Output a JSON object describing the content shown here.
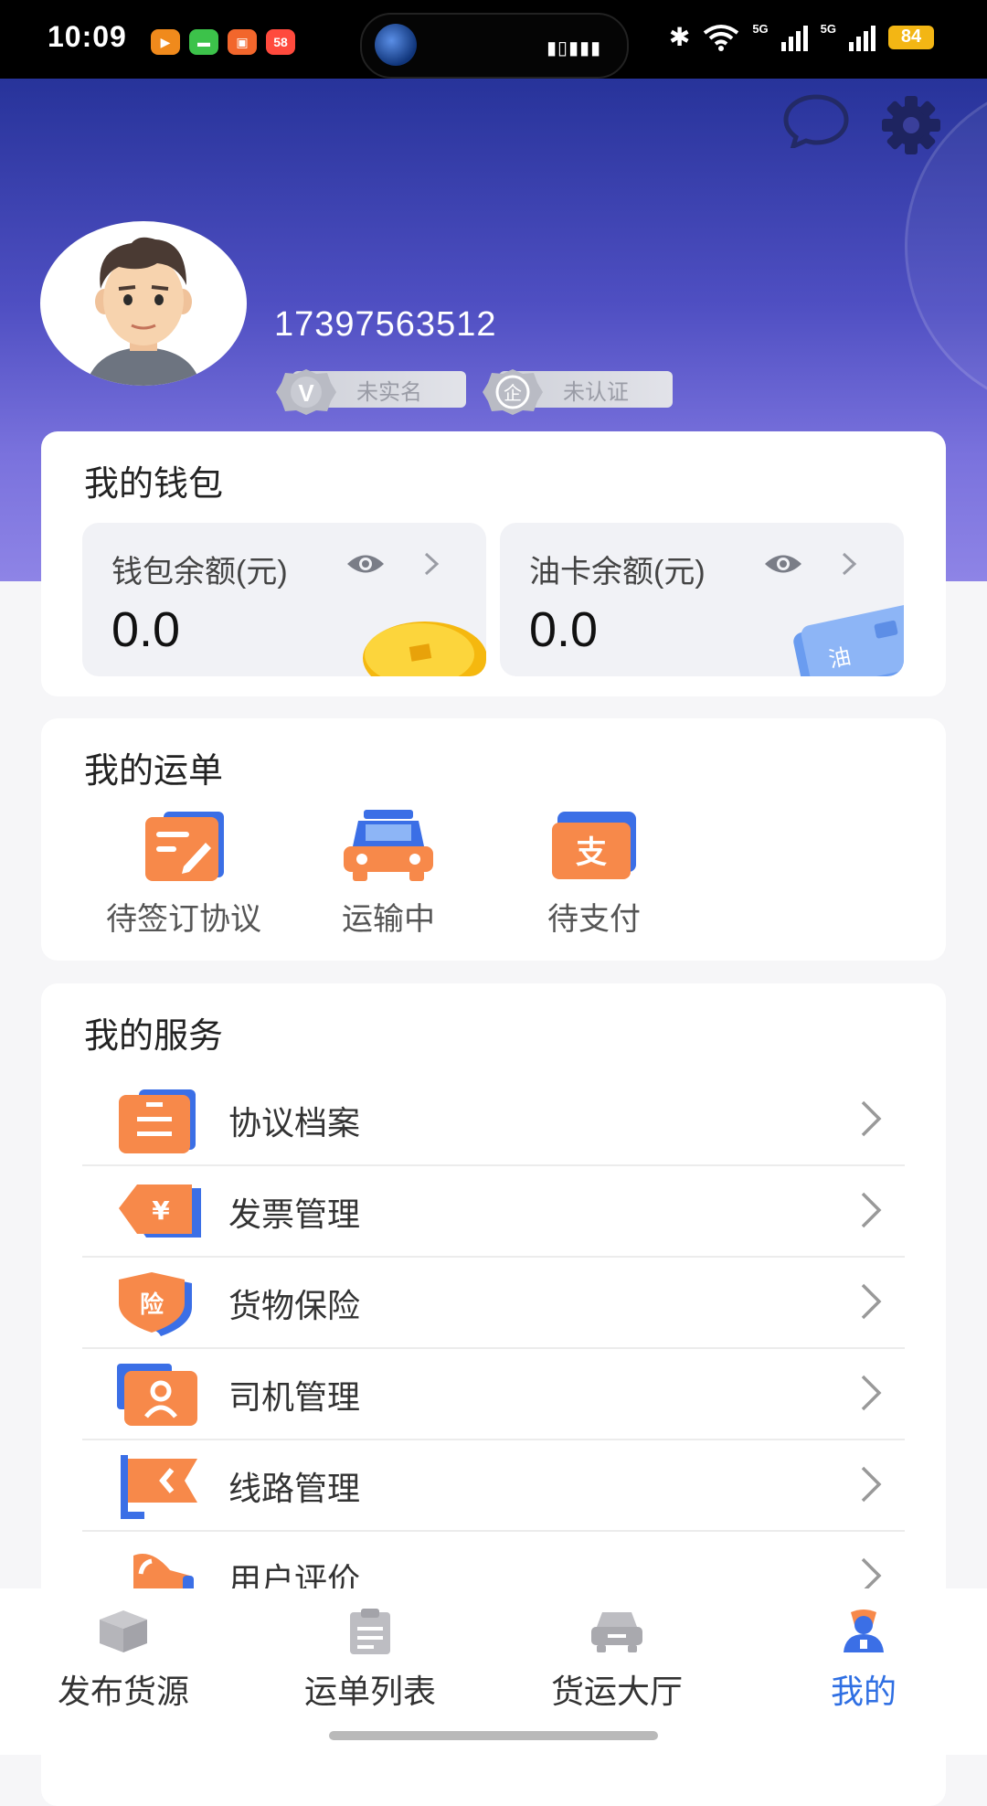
{
  "status_bar": {
    "time": "10:09",
    "app_badge": "58",
    "network_1": "5G",
    "network_2": "5G",
    "battery": "84"
  },
  "profile": {
    "phone": "17397563512",
    "badges": [
      {
        "icon_text": "V",
        "label": "未实名"
      },
      {
        "icon_text": "企",
        "label": "未认证"
      }
    ]
  },
  "wallet": {
    "title": "我的钱包",
    "items": [
      {
        "label": "钱包余额(元)",
        "value": "0.0"
      },
      {
        "label": "油卡余额(元)",
        "value": "0.0",
        "card_text": "油"
      }
    ]
  },
  "orders": {
    "title": "我的运单",
    "items": [
      {
        "label": "待签订协议"
      },
      {
        "label": "运输中"
      },
      {
        "label": "待支付",
        "icon_text": "支"
      }
    ]
  },
  "services": {
    "title": "我的服务",
    "items": [
      {
        "label": "协议档案"
      },
      {
        "label": "发票管理",
        "icon_text": "¥"
      },
      {
        "label": "货物保险",
        "icon_text": "险"
      },
      {
        "label": "司机管理"
      },
      {
        "label": "线路管理"
      },
      {
        "label": "用户评价"
      }
    ]
  },
  "tabbar": {
    "items": [
      {
        "label": "发布货源",
        "active": false
      },
      {
        "label": "运单列表",
        "active": false
      },
      {
        "label": "货运大厅",
        "active": false
      },
      {
        "label": "我的",
        "active": true
      }
    ]
  },
  "colors": {
    "accent": "#2f6fe3",
    "orange": "#f2773a",
    "header_top": "#27339a",
    "header_bottom": "#8e84e6"
  }
}
